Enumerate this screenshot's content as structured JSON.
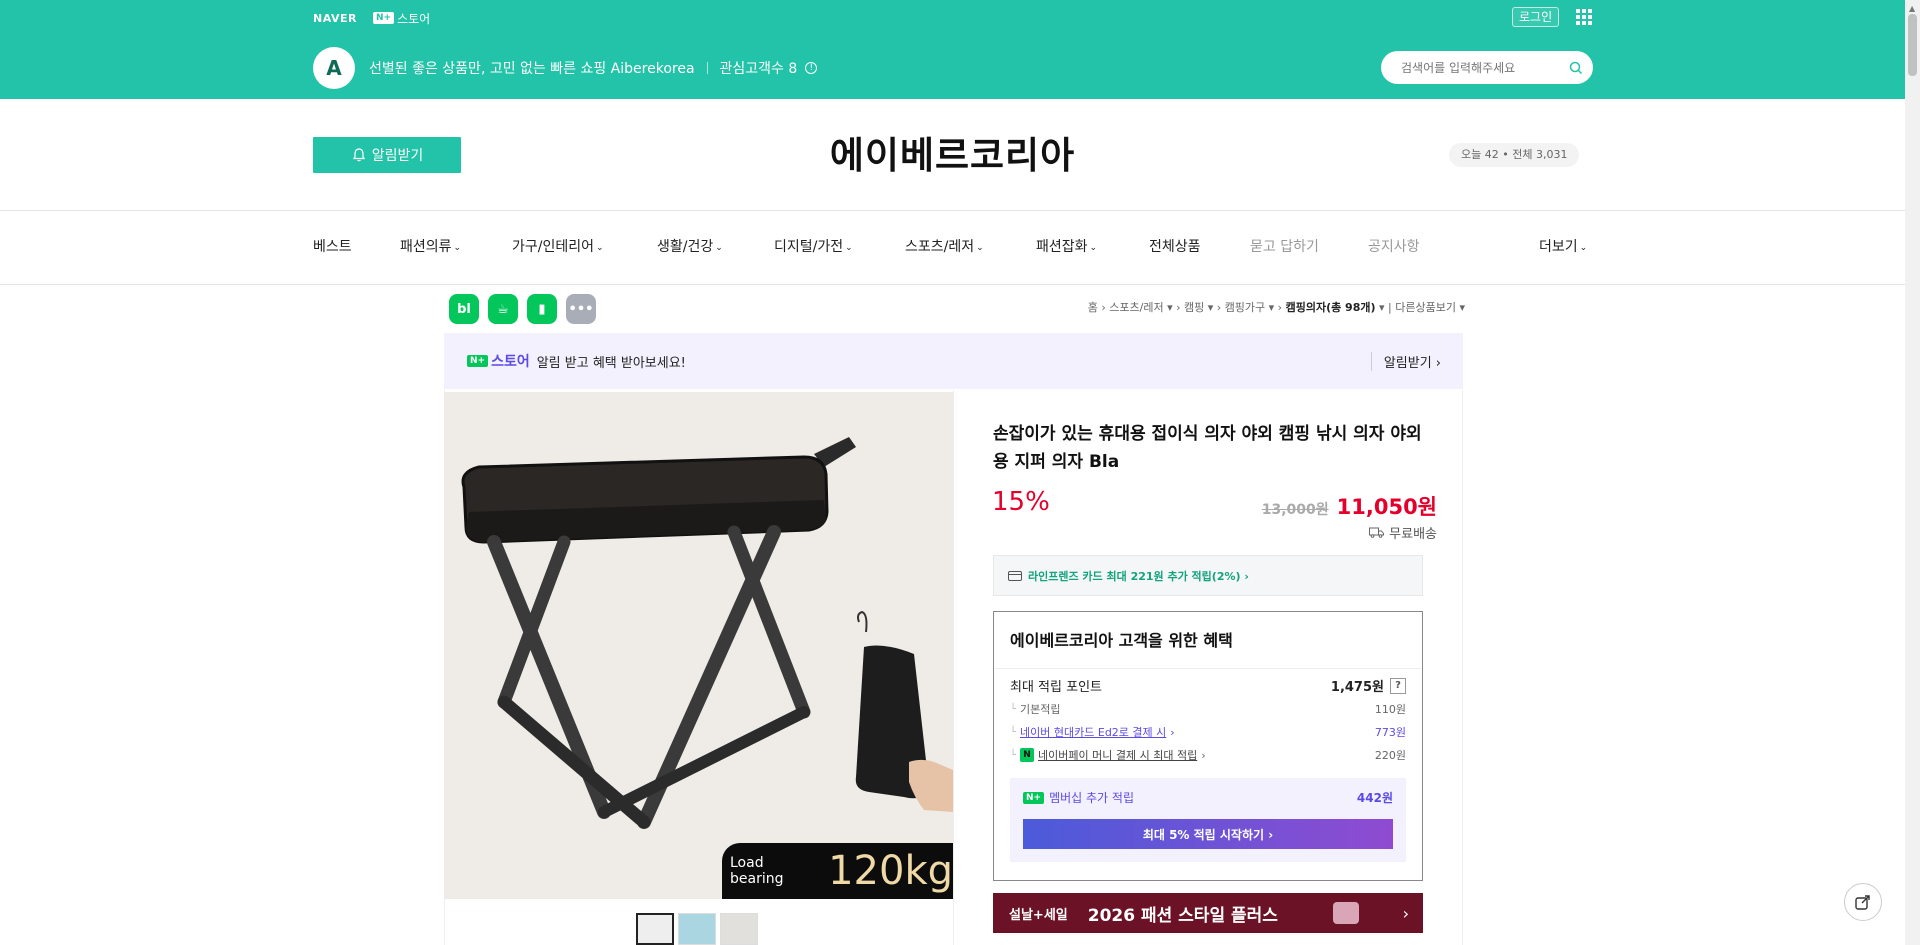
{
  "global": {
    "naver": "NAVER",
    "nplus_box": "N+",
    "store_label": "스토어",
    "login": "로그인"
  },
  "store": {
    "logo_letter": "A",
    "description": "선별된 좋은 상품만, 고민 없는 빠른 쇼핑 Aiberekorea",
    "fans": "관심고객수 8",
    "search_placeholder": "검색어를 입력해주세요"
  },
  "header": {
    "alarm_button": "알림받기",
    "title": "에이베르코리아",
    "visitors": "오늘 42 • 전체 3,031"
  },
  "nav": {
    "items": [
      {
        "label": "베스트",
        "caret": false
      },
      {
        "label": "패션의류",
        "caret": true
      },
      {
        "label": "가구/인테리어",
        "caret": true
      },
      {
        "label": "생활/건강",
        "caret": true
      },
      {
        "label": "디지털/가전",
        "caret": true
      },
      {
        "label": "스포츠/레저",
        "caret": true
      },
      {
        "label": "패션잡화",
        "caret": true
      },
      {
        "label": "전체상품",
        "caret": false
      },
      {
        "label": "묻고 답하기",
        "caret": false
      },
      {
        "label": "공지사항",
        "caret": false
      }
    ],
    "more": "더보기"
  },
  "social": {
    "blog": "bl",
    "cafe": "☕",
    "bookmark": "▮",
    "more": "•••"
  },
  "breadcrumb": {
    "home": "홈",
    "c1": "스포츠/레저",
    "c2": "캠핑",
    "c3": "캠핑가구",
    "c4": "캠핑의자(총 98개)",
    "other": "다른상품보기"
  },
  "promo": {
    "brand": "스토어",
    "text": "알림 받고 혜택 받아보세요!",
    "right": "알림받기 ›"
  },
  "product": {
    "title": "손잡이가 있는 휴대용 접이식 의자 야외 캠핑 낚시 의자 야외용 지퍼 의자 Bla",
    "discount": "15%",
    "original_price": "13,000원",
    "sale_price": "11,050원",
    "shipping": "무료배송",
    "load_text": "Load bearing",
    "load_value": "120kg",
    "card_offer": "라인프렌즈 카드 최대 221원 추가 적립(2%) ›"
  },
  "benefit": {
    "title": "에이베르코리아 고객을 위한 혜택",
    "max_points_label": "최대 적립 포인트",
    "max_points_value": "1,475원",
    "q": "?",
    "base_label": "기본적립",
    "base_value": "110원",
    "card_label": "네이버 현대카드 Ed2로 결제 시",
    "card_value": "773원",
    "npay_label": "네이버페이 머니 결제 시 최대 적립",
    "npay_value": "220원",
    "npay_icon": "N",
    "membership_label": "멤버십 추가 적립",
    "membership_value": "442원",
    "membership_button": "최대 5% 적립 시작하기 ›"
  },
  "banner": {
    "tag": "설날+세일",
    "text": "2026 패션 스타일 플러스",
    "arrow": "›"
  },
  "colors": {
    "brand_green": "#22c3a8",
    "sale_red": "#e4002b",
    "purple": "#5b4ae3"
  }
}
